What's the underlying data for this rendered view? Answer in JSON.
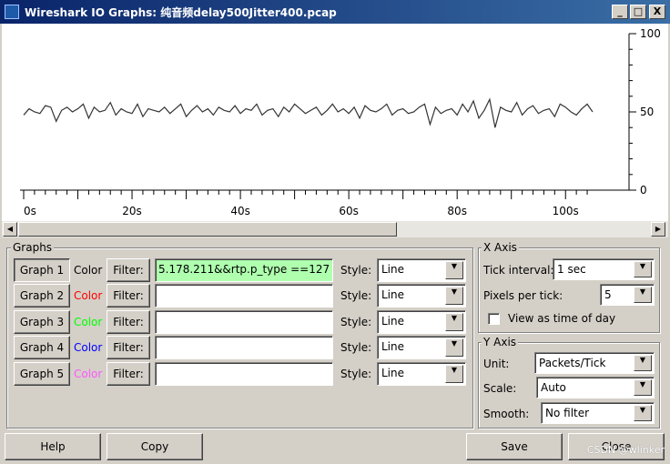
{
  "window": {
    "title": "Wireshark IO Graphs: 纯音频delay500Jitter400.pcap",
    "minimize_label": "_",
    "maximize_label": "□",
    "close_label": "X"
  },
  "graph": {
    "y_ticks": [
      "100",
      "50",
      "0"
    ],
    "x_ticks": [
      "0s",
      "20s",
      "40s",
      "60s",
      "80s",
      "100s"
    ]
  },
  "chart_data": {
    "type": "line",
    "x_unit": "s",
    "y_unit": "packets/tick",
    "xlim": [
      0,
      105
    ],
    "ylim": [
      0,
      100
    ],
    "grid": false,
    "series": [
      {
        "color": "#000000",
        "values": [
          48,
          52,
          50,
          49,
          54,
          53,
          44,
          51,
          53,
          50,
          52,
          55,
          46,
          53,
          50,
          51,
          56,
          48,
          52,
          50,
          49,
          55,
          47,
          52,
          51,
          50,
          53,
          49,
          52,
          55,
          47,
          51,
          54,
          50,
          52,
          48,
          53,
          51,
          50,
          54,
          49,
          52,
          51,
          55,
          48,
          51,
          52,
          47,
          53,
          50,
          55,
          52,
          49,
          51,
          53,
          48,
          51,
          55,
          50,
          52,
          49,
          53,
          46,
          54,
          51,
          50,
          52,
          55,
          48,
          51,
          52,
          49,
          50,
          53,
          55,
          42,
          53,
          49,
          51,
          52,
          48,
          55,
          50,
          57,
          46,
          51,
          58,
          40,
          53,
          51,
          50,
          56,
          48,
          52,
          54,
          49,
          51,
          52,
          47,
          55,
          53,
          50,
          48,
          52,
          55,
          50
        ]
      }
    ]
  },
  "graphs_group": {
    "title": "Graphs",
    "rows": [
      {
        "button": "Graph 1",
        "color_label": "Color",
        "color_hex": "#000000",
        "filter_label": "Filter:",
        "filter_value": "5.178.211&&rtp.p_type ==127",
        "style_label": "Style:",
        "style_value": "Line"
      },
      {
        "button": "Graph 2",
        "color_label": "Color",
        "color_hex": "#ff0000",
        "filter_label": "Filter:",
        "filter_value": "",
        "style_label": "Style:",
        "style_value": "Line"
      },
      {
        "button": "Graph 3",
        "color_label": "Color",
        "color_hex": "#00ff00",
        "filter_label": "Filter:",
        "filter_value": "",
        "style_label": "Style:",
        "style_value": "Line"
      },
      {
        "button": "Graph 4",
        "color_label": "Color",
        "color_hex": "#0000ff",
        "filter_label": "Filter:",
        "filter_value": "",
        "style_label": "Style:",
        "style_value": "Line"
      },
      {
        "button": "Graph 5",
        "color_label": "Color",
        "color_hex": "#ff55ff",
        "filter_label": "Filter:",
        "filter_value": "",
        "style_label": "Style:",
        "style_value": "Line"
      }
    ]
  },
  "x_axis": {
    "title": "X Axis",
    "tick_interval_label": "Tick interval:",
    "tick_interval_value": "1 sec",
    "pixels_per_tick_label": "Pixels per tick:",
    "pixels_per_tick_value": "5",
    "view_time_label": "View as time of day"
  },
  "y_axis": {
    "title": "Y Axis",
    "unit_label": "Unit:",
    "unit_value": "Packets/Tick",
    "scale_label": "Scale:",
    "scale_value": "Auto",
    "smooth_label": "Smooth:",
    "smooth_value": "No filter"
  },
  "footer": {
    "help": "Help",
    "copy": "Copy",
    "save": "Save",
    "close": "Close"
  },
  "watermark": "CSDN @wlinker"
}
